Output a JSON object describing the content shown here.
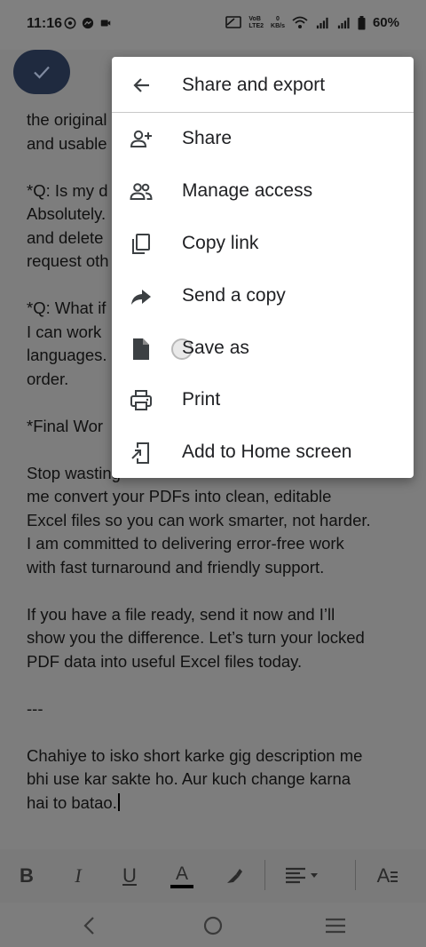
{
  "status_bar": {
    "time": "11:16",
    "network_label_top": "VoB",
    "network_label_bottom": "LTE2",
    "speed_top": "0",
    "speed_bottom": "KB/s",
    "battery": "60%"
  },
  "document": {
    "paragraphs": [
      [
        "the original",
        "and usable"
      ],
      [
        "*Q: Is my d",
        "Absolutely.",
        "and delete",
        "request oth"
      ],
      [
        "*Q: What if",
        "I can work",
        "languages.",
        "order."
      ],
      [
        "*Final Wor"
      ],
      [
        "Stop wasting",
        "me convert your PDFs into clean, editable",
        "Excel files so you can work smarter, not harder.",
        "I am committed to delivering error-free work",
        "with fast turnaround and friendly support."
      ],
      [
        "If you have a file ready, send it now and I’ll",
        "show you the difference. Let’s turn your locked",
        "PDF data into useful Excel files today."
      ],
      [
        "---"
      ],
      [
        "Chahiye to isko short karke gig description me",
        "bhi use kar sakte ho. Aur kuch change karna",
        "hai to batao."
      ]
    ]
  },
  "menu": {
    "title": "Share and export",
    "items": [
      {
        "label": "Share",
        "icon": "person-add-icon"
      },
      {
        "label": "Manage access",
        "icon": "people-icon"
      },
      {
        "label": "Copy link",
        "icon": "copy-icon"
      },
      {
        "label": "Send a copy",
        "icon": "forward-arrow-icon"
      },
      {
        "label": "Save as",
        "icon": "file-icon"
      },
      {
        "label": "Print",
        "icon": "printer-icon"
      },
      {
        "label": "Add to Home screen",
        "icon": "add-to-home-icon"
      }
    ]
  },
  "format_toolbar": {
    "bold": "B",
    "italic": "I",
    "underline": "U",
    "text_color": "A",
    "text_style": "A"
  },
  "colors": {
    "scrim_background": "#7d7d7d",
    "menu_background": "#ffffff",
    "check_fab": "#1f2a3f",
    "text_color_underline": "#000000"
  }
}
